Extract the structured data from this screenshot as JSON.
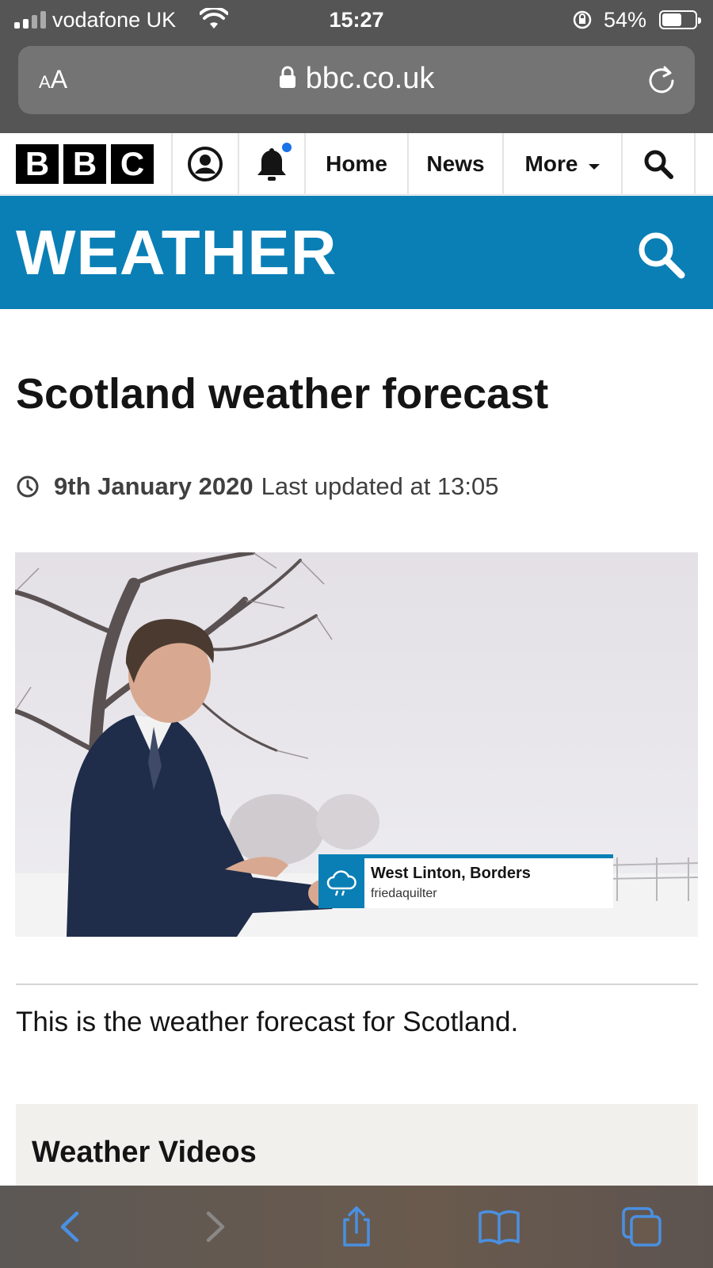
{
  "status_bar": {
    "carrier": "vodafone UK",
    "time": "15:27",
    "battery": "54%",
    "battery_level": 0.54
  },
  "safari": {
    "text_size_label_small": "A",
    "text_size_label_large": "A",
    "url": "bbc.co.uk"
  },
  "bbc_nav": {
    "logo_letters": [
      "B",
      "B",
      "C"
    ],
    "home": "Home",
    "news": "News",
    "more": "More"
  },
  "weather_banner": {
    "title": "WEATHER"
  },
  "article": {
    "title": "Scotland weather forecast",
    "date": "9th January 2020",
    "updated": "Last updated at 13:05",
    "summary": "This is the weather forecast for Scotland."
  },
  "media": {
    "caption_place": "West Linton, Borders",
    "caption_user": "friedaquilter"
  },
  "videos": {
    "heading": "Weather Videos"
  },
  "colors": {
    "bbc_weather_blue": "#0a7fb5",
    "ios_link_blue": "#4a90e2",
    "notification_dot": "#1a73e8"
  },
  "icons": [
    "signal-icon",
    "wifi-icon",
    "rotation-lock-icon",
    "battery-icon",
    "lock-icon",
    "reload-icon",
    "account-icon",
    "bell-icon",
    "search-icon",
    "clock-icon",
    "weather-cloud-icon",
    "back-icon",
    "forward-icon",
    "share-icon",
    "bookmarks-icon",
    "tabs-icon"
  ]
}
